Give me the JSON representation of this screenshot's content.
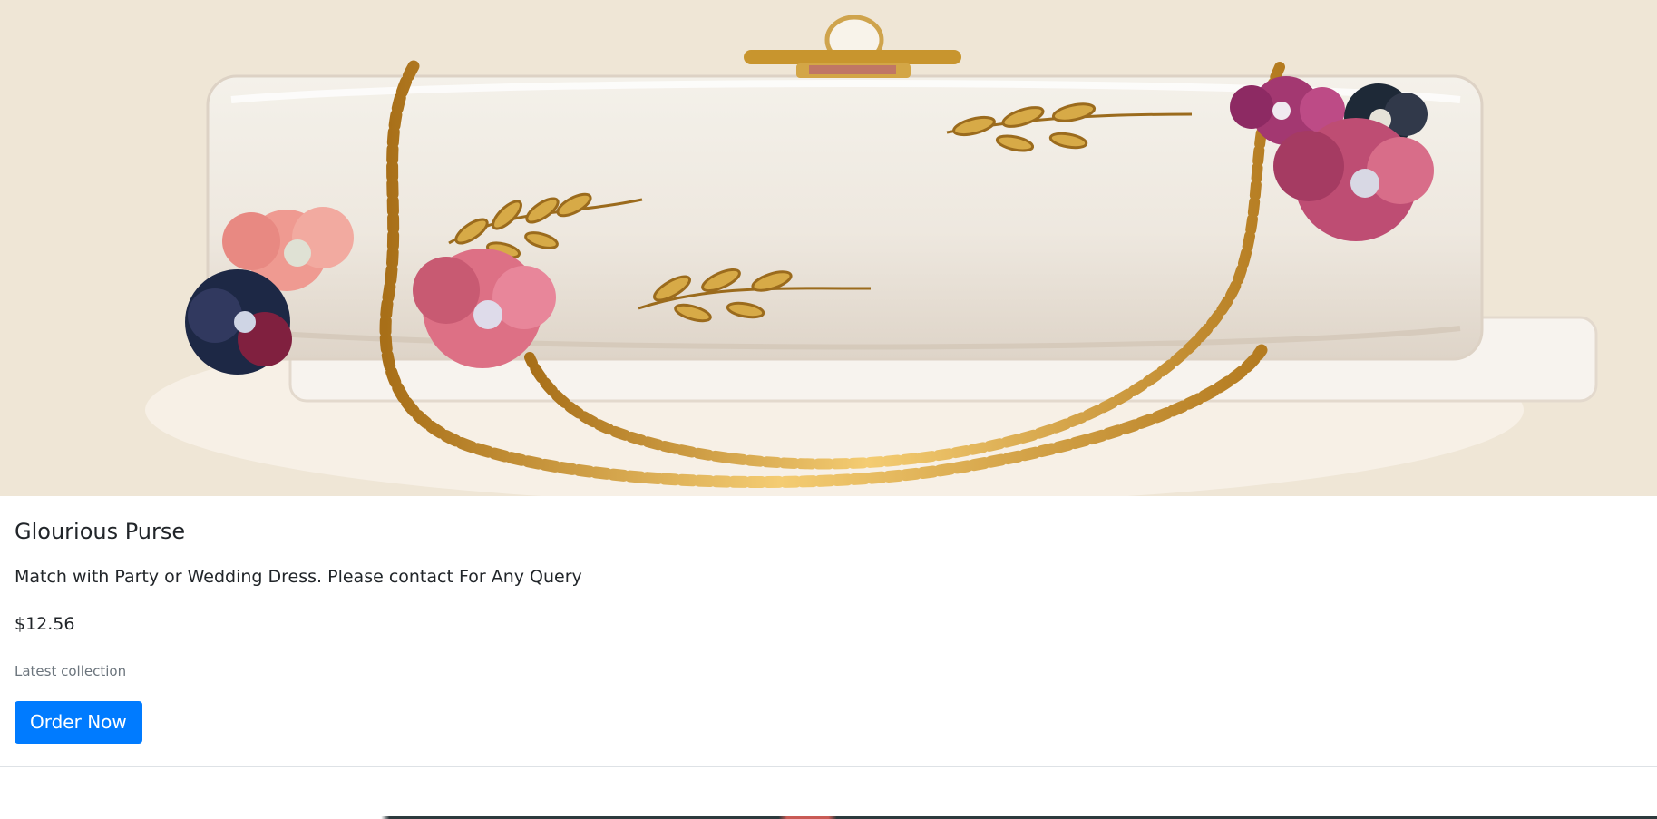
{
  "product": {
    "image_alt": "Glourious Purse",
    "title": "Glourious Purse",
    "description": "Match with Party or Wedding Dress. Please contact For Any Query",
    "price": "$12.56",
    "collection_note": "Latest collection",
    "order_button_label": "Order Now"
  },
  "colors": {
    "button": "#007bff",
    "muted_text": "#6c757d",
    "divider": "#dee2e6"
  }
}
